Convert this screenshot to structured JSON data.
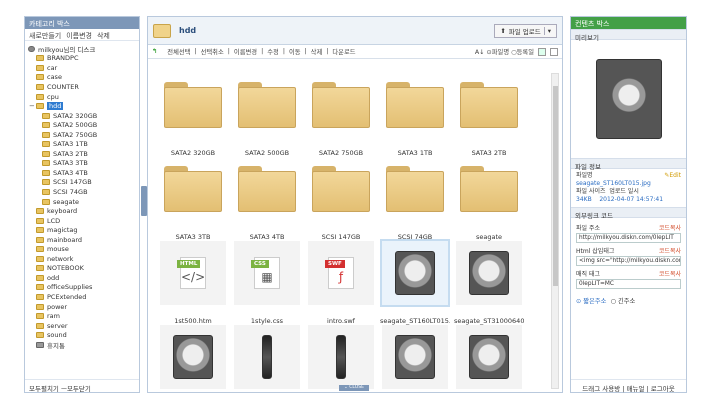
{
  "left": {
    "title": "카테고리 박스",
    "tools": [
      "새로만들기",
      "이름변경",
      "삭제"
    ],
    "root": "milkyou님의 디스크",
    "tree": [
      {
        "label": "BRANDPC",
        "level": 1
      },
      {
        "label": "car",
        "level": 1
      },
      {
        "label": "case",
        "level": 1
      },
      {
        "label": "COUNTER",
        "level": 1
      },
      {
        "label": "cpu",
        "level": 1
      },
      {
        "label": "hdd",
        "level": 1,
        "selected": true
      },
      {
        "label": "SATA2 320GB",
        "level": 2
      },
      {
        "label": "SATA2 500GB",
        "level": 2
      },
      {
        "label": "SATA2 750GB",
        "level": 2
      },
      {
        "label": "SATA3 1TB",
        "level": 2
      },
      {
        "label": "SATA3 2TB",
        "level": 2
      },
      {
        "label": "SATA3 3TB",
        "level": 2
      },
      {
        "label": "SATA3 4TB",
        "level": 2
      },
      {
        "label": "SCSI 147GB",
        "level": 2
      },
      {
        "label": "SCSI 74GB",
        "level": 2
      },
      {
        "label": "seagate",
        "level": 2
      },
      {
        "label": "keyboard",
        "level": 1
      },
      {
        "label": "LCD",
        "level": 1
      },
      {
        "label": "magictag",
        "level": 1
      },
      {
        "label": "mainboard",
        "level": 1
      },
      {
        "label": "mouse",
        "level": 1
      },
      {
        "label": "network",
        "level": 1
      },
      {
        "label": "NOTEBOOK",
        "level": 1
      },
      {
        "label": "odd",
        "level": 1
      },
      {
        "label": "officeSupplies",
        "level": 1
      },
      {
        "label": "PCExtended",
        "level": 1
      },
      {
        "label": "power",
        "level": 1
      },
      {
        "label": "ram",
        "level": 1
      },
      {
        "label": "server",
        "level": 1
      },
      {
        "label": "sound",
        "level": 1
      },
      {
        "label": "휴지통",
        "level": 1
      }
    ],
    "footer": "모두펼치기 ㅡ모두닫기"
  },
  "center": {
    "path": "hdd",
    "upload": "파일 업로드",
    "back": "↰",
    "toolbar": [
      "전체선택",
      "선택취소",
      "이름변경",
      "수정",
      "이동",
      "삭제",
      "다운로드"
    ],
    "sort": "A↓ ⊙파일명 ○등록일",
    "items": [
      {
        "name": "SATA2 320GB",
        "kind": "folder"
      },
      {
        "name": "SATA2 500GB",
        "kind": "folder"
      },
      {
        "name": "SATA2 750GB",
        "kind": "folder"
      },
      {
        "name": "SATA3 1TB",
        "kind": "folder"
      },
      {
        "name": "SATA3 2TB",
        "kind": "folder"
      },
      {
        "name": "SATA3 3TB",
        "kind": "folder"
      },
      {
        "name": "SATA3 4TB",
        "kind": "folder"
      },
      {
        "name": "SCSI 147GB",
        "kind": "folder"
      },
      {
        "name": "SCSI 74GB",
        "kind": "folder"
      },
      {
        "name": "seagate",
        "kind": "folder"
      },
      {
        "name": "1st500.htm",
        "kind": "html",
        "tag": "HTML",
        "tagColor": "#7cb342",
        "glyph": "</>"
      },
      {
        "name": "1style.css",
        "kind": "css",
        "tag": "CSS",
        "tagColor": "#7cb342",
        "glyph": "▦"
      },
      {
        "name": "intro.swf",
        "kind": "swf",
        "tag": "SWF",
        "tagColor": "#d32f2f",
        "glyph": "ƒ"
      },
      {
        "name": "seagate_ST160LT015.j",
        "kind": "hdd",
        "selected": true
      },
      {
        "name": "seagate_ST31000640S",
        "kind": "hdd"
      },
      {
        "name": "",
        "kind": "hdd"
      },
      {
        "name": "",
        "kind": "hdd-thin"
      },
      {
        "name": "",
        "kind": "hdd-thin"
      },
      {
        "name": "",
        "kind": "hdd"
      },
      {
        "name": "",
        "kind": "hdd"
      }
    ],
    "side_handle": "OPEN",
    "bottom_handle": "⌄ CLOSE"
  },
  "right": {
    "title": "컨텐츠 박스",
    "preview_title": "미리보기",
    "info_title": "파일 정보",
    "info": {
      "filename_label": "파일명",
      "edit_label": "✎Edit",
      "filename": "seagate_ST160LT015.jpg",
      "size_label": "파일 사이즈",
      "date_label": "업로드 일시",
      "size": "34KB",
      "date": "2012-04-07 14:57:41"
    },
    "link_title": "외부링크 코드",
    "links": [
      {
        "label": "파일 주소",
        "copy": "코드복사",
        "value": "http://milkyou.diskn.com/0lepLIT"
      },
      {
        "label": "Html 삽입태그",
        "copy": "코드복사",
        "value": "<img src=\"http://milkyou.diskn.com"
      },
      {
        "label": "매직 태그",
        "copy": "코드복사",
        "value": "0lepLIT=MC"
      }
    ],
    "radios": [
      "짧은주소",
      "긴주소"
    ],
    "footer": "드래그 사용방 | 매뉴얼 | 로그아웃"
  }
}
